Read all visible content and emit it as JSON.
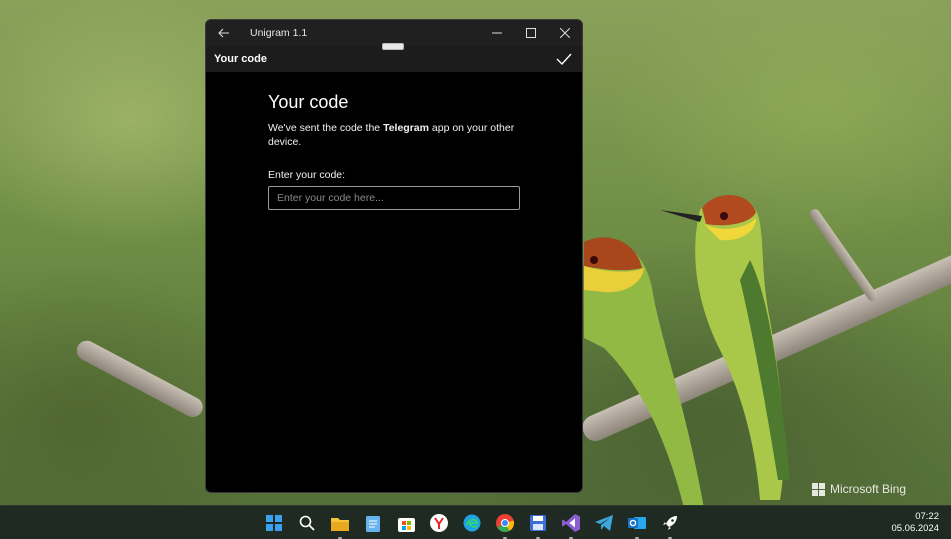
{
  "window": {
    "app_title": "Unigram 1.1",
    "header_title": "Your code"
  },
  "page": {
    "heading": "Your code",
    "desc_before": "We've sent the code the ",
    "desc_bold": "Telegram",
    "desc_after": " app on your other device.",
    "field_label": "Enter your code:",
    "input_placeholder": "Enter your code here...",
    "input_value": ""
  },
  "wallpaper": {
    "watermark": "Microsoft Bing"
  },
  "taskbar": {
    "apps": [
      {
        "name": "start-icon",
        "color": "#3aa0f0"
      },
      {
        "name": "search-icon",
        "color": "#ffffff"
      },
      {
        "name": "file-explorer-icon",
        "color": "#f6c33a"
      },
      {
        "name": "notepad-icon",
        "color": "#67b3f0"
      },
      {
        "name": "microsoft-store-icon",
        "color": "#ffffff"
      },
      {
        "name": "yandex-browser-icon",
        "color": "#ffffff"
      },
      {
        "name": "edge-icon",
        "color": "#1fa3e3"
      },
      {
        "name": "chrome-icon",
        "color": "#e94235"
      },
      {
        "name": "save-app-icon",
        "color": "#3a6fd8"
      },
      {
        "name": "visual-studio-icon",
        "color": "#8a5fd0"
      },
      {
        "name": "telegram-icon",
        "color": "#3fa7e0"
      },
      {
        "name": "outlook-icon",
        "color": "#1470c8"
      },
      {
        "name": "rocket-app-icon",
        "color": "#ffffff"
      }
    ],
    "time": "07:22",
    "date": "05.06.2024"
  }
}
